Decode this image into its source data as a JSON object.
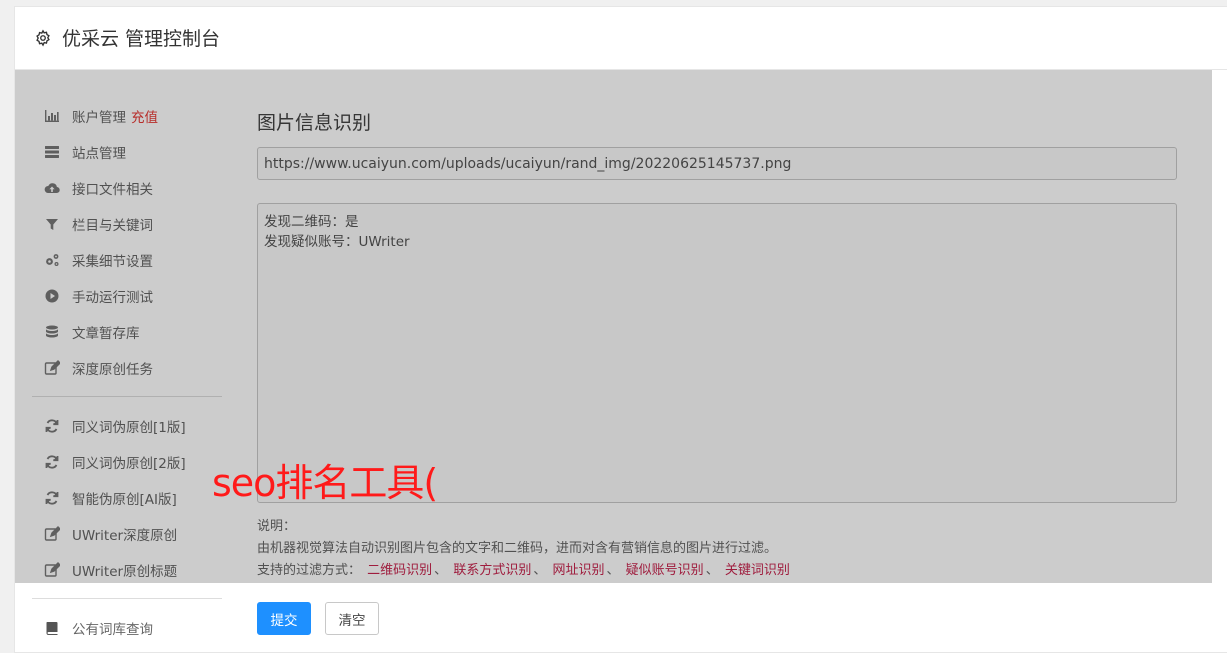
{
  "header": {
    "title": "优采云 管理控制台",
    "icon": "gear-icon"
  },
  "sidebar": {
    "items": [
      {
        "label": "账户管理",
        "badge": "充值",
        "icon": "bar-chart-icon"
      },
      {
        "label": "站点管理",
        "icon": "server-icon"
      },
      {
        "label": "接口文件相关",
        "icon": "cloud-upload-icon"
      },
      {
        "label": "栏目与关键词",
        "icon": "filter-icon"
      },
      {
        "label": "采集细节设置",
        "icon": "gears-icon"
      },
      {
        "label": "手动运行测试",
        "icon": "play-circle-icon"
      },
      {
        "label": "文章暂存库",
        "icon": "database-icon"
      },
      {
        "label": "深度原创任务",
        "icon": "edit-icon"
      }
    ],
    "items2": [
      {
        "label": "同义词伪原创[1版]",
        "icon": "refresh-icon"
      },
      {
        "label": "同义词伪原创[2版]",
        "icon": "refresh-icon"
      },
      {
        "label": "智能伪原创[AI版]",
        "icon": "refresh-icon"
      },
      {
        "label": "UWriter深度原创",
        "icon": "edit-icon"
      },
      {
        "label": "UWriter原创标题",
        "icon": "edit-icon"
      }
    ],
    "items3": [
      {
        "label": "公有词库查询",
        "icon": "book-icon"
      }
    ]
  },
  "main": {
    "title": "图片信息识别",
    "url_value": "https://www.ucaiyun.com/uploads/ucaiyun/rand_img/20220625145737.png",
    "result_lines": [
      "发现二维码：是",
      "发现疑似账号：UWriter"
    ],
    "note_label": "说明：",
    "note_desc": "由机器视觉算法自动识别图片包含的文字和二维码，进而对含有营销信息的图片进行过滤。",
    "filters_label": "支持的过滤方式：",
    "filters": [
      "二维码识别",
      "联系方式识别",
      "网址识别",
      "疑似账号识别",
      "关键词识别"
    ],
    "separator": "、",
    "submit_label": "提交",
    "clear_label": "清空"
  },
  "watermark": "seo排名工具("
}
